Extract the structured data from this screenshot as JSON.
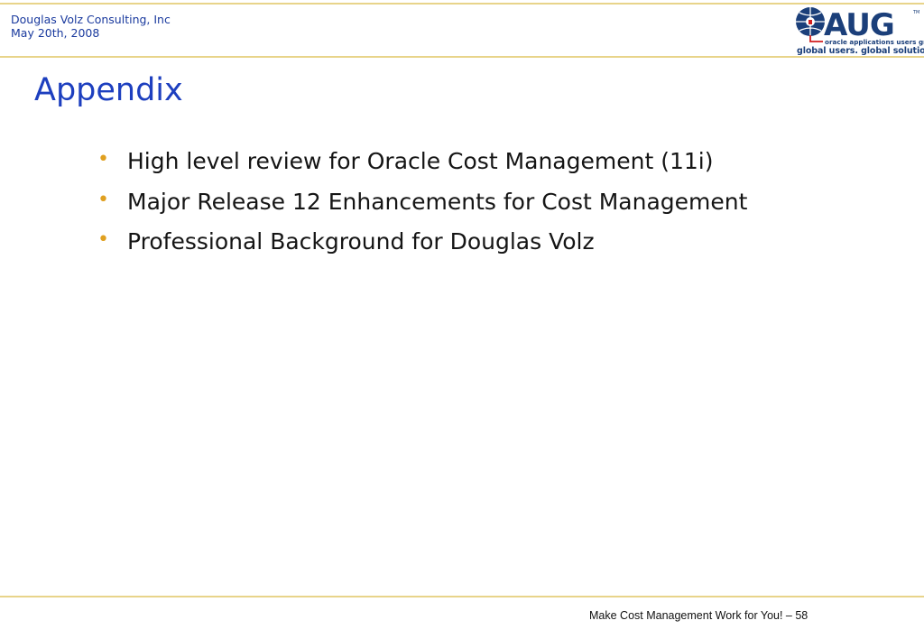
{
  "header": {
    "company": "Douglas Volz Consulting, Inc",
    "date": "May 20th, 2008"
  },
  "logo": {
    "letters": [
      "O",
      "A",
      "U",
      "G"
    ],
    "trademark": "TM",
    "subtitle": "oracle applications users group",
    "tagline": "global users. global solutions.",
    "colors": {
      "navy": "#1b3f7a",
      "red": "#d21f1f",
      "gold": "#e0a020"
    }
  },
  "slide": {
    "title": "Appendix",
    "bullets": [
      "High level review for Oracle Cost Management (11i)",
      "Major Release 12 Enhancements for Cost Management",
      "Professional Background for Douglas Volz"
    ],
    "bullet_symbol": "•"
  },
  "footer": {
    "text": "Make Cost Management Work for You! – 58"
  }
}
